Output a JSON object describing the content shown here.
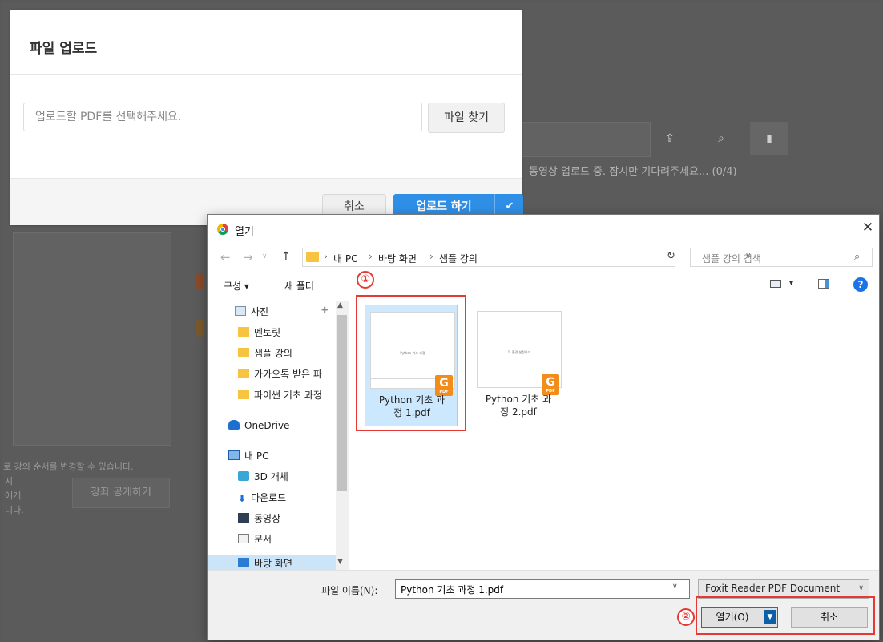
{
  "background": {
    "status_text": "동영상 업로드 중. 잠시만 기다려주세요... (0/4)",
    "hint_text": "로 강의 순서를 변경할 수 있습니다.",
    "side_lines": [
      "지",
      "에게",
      "니다."
    ],
    "publish_button": "강좌 공개하기"
  },
  "upload_modal": {
    "title": "파일 업로드",
    "input_placeholder": "업로드할 PDF를 선택해주세요.",
    "find_button": "파일 찾기",
    "cancel_button": "취소",
    "upload_button": "업로드 하기"
  },
  "open_dialog": {
    "title": "열기",
    "breadcrumb": [
      "내 PC",
      "바탕 화면",
      "샘플 강의"
    ],
    "search_placeholder": "샘플 강의 검색",
    "toolbar": {
      "organize": "구성 ▾",
      "new_folder": "새 폴더"
    },
    "nav_items": [
      {
        "label": "사진",
        "icon": "photo-icon"
      },
      {
        "label": "멘토릿",
        "icon": "folder-icon"
      },
      {
        "label": "샘플 강의",
        "icon": "folder-icon"
      },
      {
        "label": "카카오톡 받은 파",
        "icon": "folder-icon"
      },
      {
        "label": "파이썬 기초 과정",
        "icon": "folder-icon"
      },
      {
        "label": "OneDrive",
        "icon": "cloud-icon"
      },
      {
        "label": "내 PC",
        "icon": "pc-icon"
      },
      {
        "label": "3D 개체",
        "icon": "3d-objects-icon"
      },
      {
        "label": "다운로드",
        "icon": "download-icon"
      },
      {
        "label": "동영상",
        "icon": "video-icon"
      },
      {
        "label": "문서",
        "icon": "document-icon"
      },
      {
        "label": "바탕 화면",
        "icon": "desktop-icon"
      }
    ],
    "files": [
      {
        "name": "Python 기초 과정 1.pdf",
        "line1": "Python 기초 과",
        "line2": "정 1.pdf",
        "thumb_text": "Python 기초 과정",
        "selected": true
      },
      {
        "name": "Python 기초 과정 2.pdf",
        "line1": "Python 기초 과",
        "line2": "정 2.pdf",
        "thumb_text": "1. 환경 설정하기",
        "selected": false
      }
    ],
    "filename_label": "파일 이름(N):",
    "filename_value": "Python 기초 과정 1.pdf",
    "file_type": "Foxit Reader PDF Document",
    "open_button": "열기(O)",
    "cancel_button": "취소"
  },
  "annotations": {
    "step1": "①",
    "step2": "②",
    "color": "#e53935"
  },
  "colors": {
    "accent": "#2f8fe6",
    "selection": "#cce8ff"
  }
}
